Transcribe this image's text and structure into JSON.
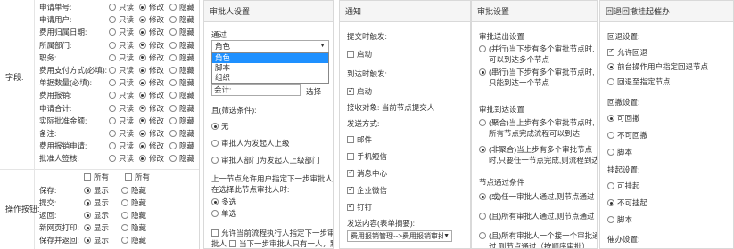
{
  "fields": {
    "section_label": "字段:",
    "options": [
      "只读",
      "修改",
      "隐藏"
    ],
    "rows": [
      {
        "name": "申请单号:",
        "selected": 1
      },
      {
        "name": "申请用户:",
        "selected": 1
      },
      {
        "name": "费用归属日期:",
        "selected": 1
      },
      {
        "name": "所属部门:",
        "selected": 1
      },
      {
        "name": "职务:",
        "selected": 1
      },
      {
        "name": "费用支付方式(必填):",
        "selected": 1
      },
      {
        "name": "单据数量(必填):",
        "selected": 1
      },
      {
        "name": "费用报销:",
        "selected": 1
      },
      {
        "name": "申请合计:",
        "selected": 1
      },
      {
        "name": "实际批准金额:",
        "selected": 1
      },
      {
        "name": "备注:",
        "selected": 1
      },
      {
        "name": "费用报销申请:",
        "selected": 1
      },
      {
        "name": "批准人签核:",
        "selected": 1
      }
    ]
  },
  "buttons_section": {
    "label": "操作按钮:",
    "all_label_1": "所有",
    "all_label_2": "所有",
    "options": [
      "显示",
      "隐藏"
    ],
    "rows": [
      {
        "name": "保存:",
        "selected": 0
      },
      {
        "name": "提交:",
        "selected": 0
      },
      {
        "name": "返回:",
        "selected": 0
      },
      {
        "name": "新网页打印:",
        "selected": 0
      },
      {
        "name": "保存并返回:",
        "selected": 0
      }
    ]
  },
  "approver": {
    "header": "审批人设置",
    "by_label": "通过",
    "select_value": "角色",
    "dropdown_options": [
      "角色",
      "脚本",
      "组织"
    ],
    "dropdown_selected": 0,
    "field_label": "会计:",
    "select_button": "选择",
    "condition_label": "且(筛选条件):",
    "condition_options": [
      "无",
      "审批人为发起人上级",
      "审批人部门为发起人上级部门"
    ],
    "condition_selected": 0,
    "prev_node_text_1": "上一节点允许用户指定下一步审批人,",
    "prev_node_text_2": "在选择此节点审批人时:",
    "select_mode_options": [
      "多选",
      "单选"
    ],
    "select_mode_selected": 0,
    "allow_current_text": "允许当前流程执行人指定下一步审",
    "allow_current_text_2": "批人",
    "next_single_text": "当下一步审批人只有一人，默"
  },
  "notify": {
    "header": "通知",
    "submit_label": "提交时触发:",
    "submit_start": "启动",
    "arrive_label": "到达时触发:",
    "arrive_start": "启动",
    "recipient_text": "接收对象: 当前节点提交人",
    "method_label": "发送方式:",
    "methods": [
      {
        "label": "邮件",
        "checked": false
      },
      {
        "label": "手机短信",
        "checked": false
      },
      {
        "label": "消息中心",
        "checked": true
      },
      {
        "label": "企业微信",
        "checked": true
      },
      {
        "label": "钉钉",
        "checked": true
      }
    ],
    "content_label": "发送内容(表单摘要):",
    "content_value": "费用报销管理-->费用报销审批"
  },
  "approval_settings": {
    "header": "审批设置",
    "send_label": "审批送出设置",
    "send_options": [
      "(并行)当下步有多个审批节点时,可以到达多个节点",
      "(串行)当下步有多个审批节点时,只能到达一个节点"
    ],
    "send_selected": 1,
    "arrive_label": "审批到达设置",
    "arrive_options": [
      "(聚合)当上步有多个审批节点时,所有节点完成流程可以到达",
      "(非聚合)当上步有多个审批节点时,只要任一节点完成,则流程到达"
    ],
    "arrive_selected": 1,
    "pass_label": "节点通过条件",
    "pass_options": [
      "(或)任一审批人通过,则节点通过",
      "(且)所有审批人通过,则节点通过",
      "(且)所有审批人一个接一个审批通过,则节点通过（按顺序审批）"
    ],
    "pass_selected": 0
  },
  "rollback": {
    "header": "回退回撤挂起催办",
    "rollback_label": "回退设置:",
    "allow_rollback": "允许回退",
    "rollback_options": [
      "前台操作用户指定回退节点",
      "回退至指定节点"
    ],
    "rollback_selected": 0,
    "recall_label": "回撤设置:",
    "recall_options": [
      "可回撤",
      "不可回撤",
      "脚本"
    ],
    "recall_selected": 0,
    "suspend_label": "挂起设置:",
    "suspend_options": [
      "可挂起",
      "不可挂起",
      "脚本"
    ],
    "suspend_selected": 1,
    "urge_label": "催办设置:"
  }
}
